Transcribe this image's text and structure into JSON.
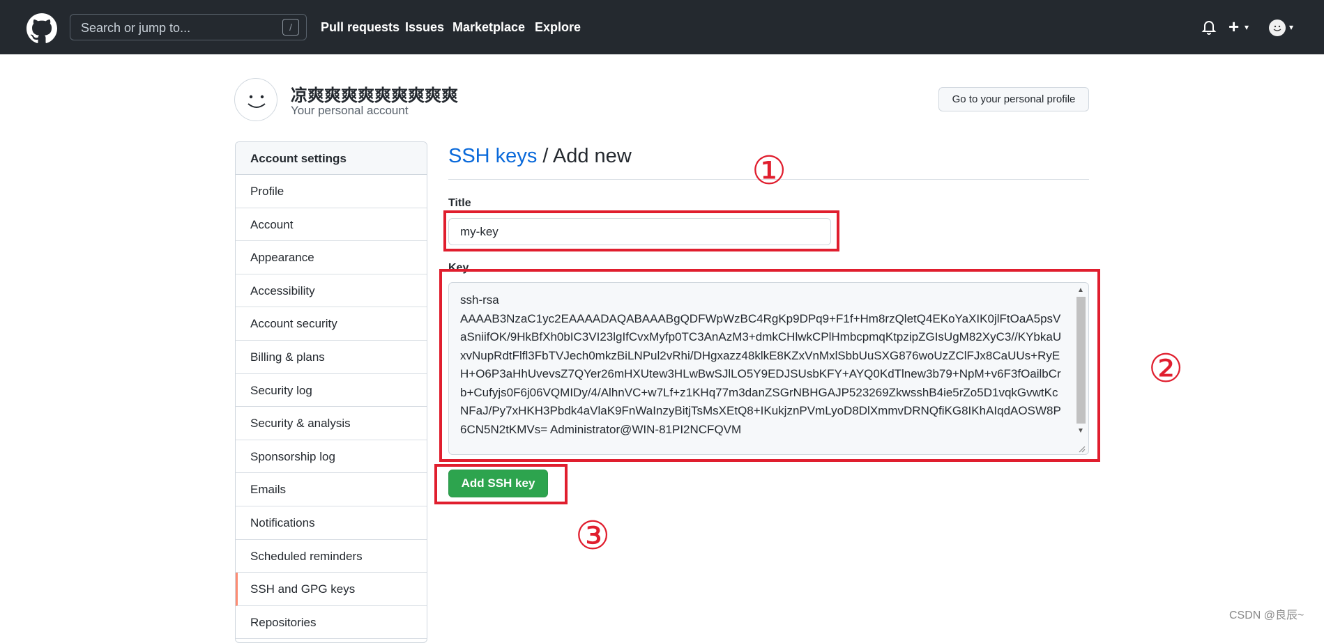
{
  "header": {
    "search_placeholder": "Search or jump to...",
    "search_shortcut": "/",
    "nav": [
      "Pull requests",
      "Issues",
      "Marketplace",
      "Explore"
    ]
  },
  "account": {
    "name": "凉爽爽爽爽爽爽爽爽爽",
    "subtitle": "Your personal account",
    "profile_button": "Go to your personal profile"
  },
  "sidebar": {
    "heading": "Account settings",
    "items": [
      "Profile",
      "Account",
      "Appearance",
      "Accessibility",
      "Account security",
      "Billing & plans",
      "Security log",
      "Security & analysis",
      "Sponsorship log",
      "Emails",
      "Notifications",
      "Scheduled reminders",
      "SSH and GPG keys",
      "Repositories"
    ],
    "active_item": "SSH and GPG keys"
  },
  "main": {
    "crumb_link": "SSH keys",
    "crumb_rest": " / Add new",
    "title_label": "Title",
    "title_value": "my-key",
    "key_label": "Key",
    "key_value": "ssh-rsa\nAAAAB3NzaC1yc2EAAAADAQABAAABgQDFWpWzBC4RgKp9DPq9+F1f+Hm8rzQletQ4EKoYaXIK0jlFtOaA5psVaSniifOK/9HkBfXh0bIC3VI23lgIfCvxMyfp0TC3AnAzM3+dmkCHlwkCPlHmbcpmqKtpzipZGIsUgM82XyC3//KYbkaUxvNupRdtFlfl3FbTVJech0mkzBiLNPul2vRhi/DHgxazz48klkE8KZxVnMxlSbbUuSXG876woUzZClFJx8CaUUs+RyEH+O6P3aHhUvevsZ7QYer26mHXUtew3HLwBwSJlLO5Y9EDJSUsbKFY+AYQ0KdTlnew3b79+NpM+v6F3fOailbCrb+Cufyjs0F6j06VQMIDy/4/AlhnVC+w7Lf+z1KHq77m3danZSGrNBHGAJP523269ZkwsshB4ie5rZo5D1vqkGvwtKcNFaJ/Py7xHKH3Pbdk4aVlaK9FnWaInzyBitjTsMsXEtQ8+IKukjznPVmLyoD8DlXmmvDRNQfiKG8IKhAIqdAOSW8P6CN5N2tKMVs= Administrator@WIN-81PI2NCFQVM",
    "add_button": "Add SSH key"
  },
  "annotations": [
    "①",
    "②",
    "③"
  ],
  "watermark": "CSDN @良辰~",
  "colors": {
    "header_bg": "#24292f",
    "link_blue": "#0969da",
    "button_green": "#2da44e",
    "annotation_red": "#e01e2e",
    "active_marker": "#fd8c73"
  }
}
